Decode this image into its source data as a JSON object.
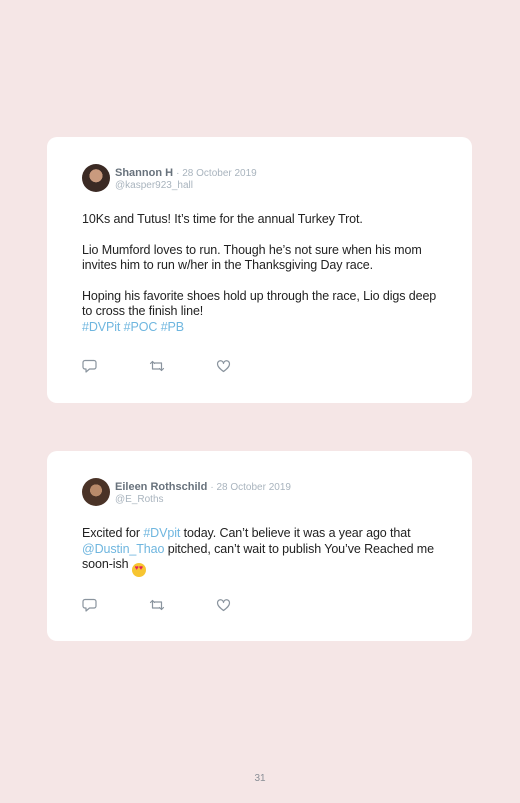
{
  "tweets": [
    {
      "name": "Shannon H",
      "date": "· 28 October 2019",
      "handle": "@kasper923_hall",
      "para1": "10Ks and Tutus! It’s time for the annual Turkey Trot.",
      "para2": "Lio Mumford loves to run. Though he’s not sure when his mom invites him to run w/her in the Thanksgiving Day race.",
      "para3": "Hoping his favorite shoes hold up through the race, Lio digs deep to cross the finish line!",
      "hashtags": "#DVPit #POC #PB"
    },
    {
      "name": "Eileen Rothschild",
      "date": "· 28 October 2019",
      "handle": "@E_Roths",
      "text_start": "Excited for ",
      "hashtag": "#DVpit",
      "text_mid": " today. Can’t believe it was a year ago that ",
      "mention": "@Dustin_Thao",
      "text_end": " pitched, can’t wait to publish You’ve Reached me soon-ish ",
      "emoji": "😍"
    }
  ],
  "icons": [
    "reply-icon",
    "retweet-icon",
    "like-icon"
  ],
  "page_number": "31"
}
